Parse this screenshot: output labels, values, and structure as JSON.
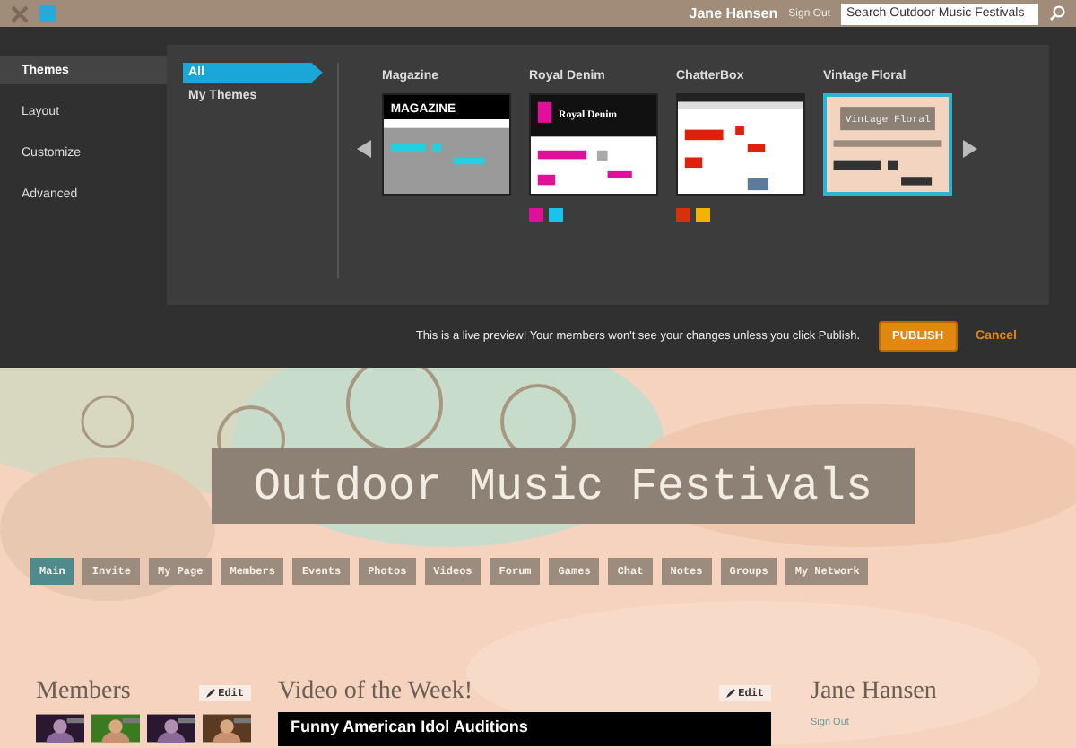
{
  "top_bar": {
    "user_name": "Jane Hansen",
    "sign_out": "Sign Out",
    "search": {
      "placeholder": "Search Outdoor Music Festivals"
    }
  },
  "sidebar": {
    "items": [
      {
        "label": "Themes",
        "selected": true
      },
      {
        "label": "Layout",
        "selected": false
      },
      {
        "label": "Customize",
        "selected": false
      },
      {
        "label": "Advanced",
        "selected": false
      }
    ]
  },
  "filters": [
    {
      "label": "All",
      "selected": true
    },
    {
      "label": "My Themes",
      "selected": false
    }
  ],
  "themes": [
    {
      "name": "Magazine",
      "kind": "magazine",
      "thumb_title": "MAGAZINE",
      "selected": false
    },
    {
      "name": "Royal Denim",
      "kind": "denim",
      "thumb_title": "Royal Denim",
      "selected": false,
      "swatches": [
        {
          "color": "#e0109a"
        },
        {
          "color": "#1cc3e8"
        }
      ]
    },
    {
      "name": "ChatterBox",
      "kind": "chatter",
      "selected": false,
      "swatches": [
        {
          "color": "#d8300c"
        },
        {
          "color": "#f0b400"
        }
      ]
    },
    {
      "name": "Vintage Floral",
      "kind": "floral",
      "thumb_title": "Vintage Floral",
      "selected": true
    }
  ],
  "preview_notice": "This is a live preview! Your members won't see your changes unless you click Publish.",
  "publish_button": "PUBLISH",
  "cancel_link": "Cancel",
  "site": {
    "title": "Outdoor Music Festivals",
    "nav": [
      {
        "label": "Main",
        "selected": true
      },
      {
        "label": "Invite",
        "selected": false
      },
      {
        "label": "My Page",
        "selected": false
      },
      {
        "label": "Members",
        "selected": false
      },
      {
        "label": "Events",
        "selected": false
      },
      {
        "label": "Photos",
        "selected": false
      },
      {
        "label": "Videos",
        "selected": false
      },
      {
        "label": "Forum",
        "selected": false
      },
      {
        "label": "Games",
        "selected": false
      },
      {
        "label": "Chat",
        "selected": false
      },
      {
        "label": "Notes",
        "selected": false
      },
      {
        "label": "Groups",
        "selected": false
      },
      {
        "label": "My Network",
        "selected": false
      }
    ],
    "members": {
      "heading": "Members",
      "edit": "Edit"
    },
    "video": {
      "heading": "Video of the Week!",
      "edit": "Edit",
      "title": "Funny American Idol Auditions"
    },
    "profile": {
      "name": "Jane Hansen",
      "sign_out": "Sign Out"
    }
  }
}
